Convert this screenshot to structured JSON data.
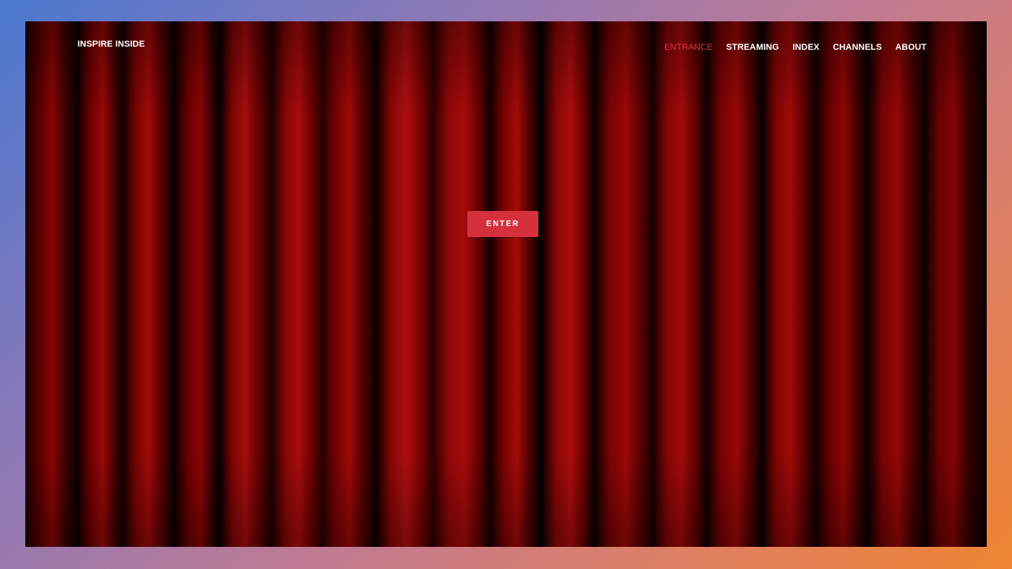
{
  "site": {
    "logo": "INSPIRE INSIDE"
  },
  "nav": {
    "items": [
      {
        "label": "ENTRANCE",
        "active": true
      },
      {
        "label": "STREAMING",
        "active": false
      },
      {
        "label": "INDEX",
        "active": false
      },
      {
        "label": "CHANNELS",
        "active": false
      },
      {
        "label": "ABOUT",
        "active": false
      }
    ]
  },
  "hero": {
    "button_label": "ENTER",
    "background": "red-stage-curtain"
  },
  "colors": {
    "accent": "#d5313d",
    "nav_text": "#ffffff",
    "nav_active": "#d9323f",
    "curtain": "#8a0505"
  }
}
